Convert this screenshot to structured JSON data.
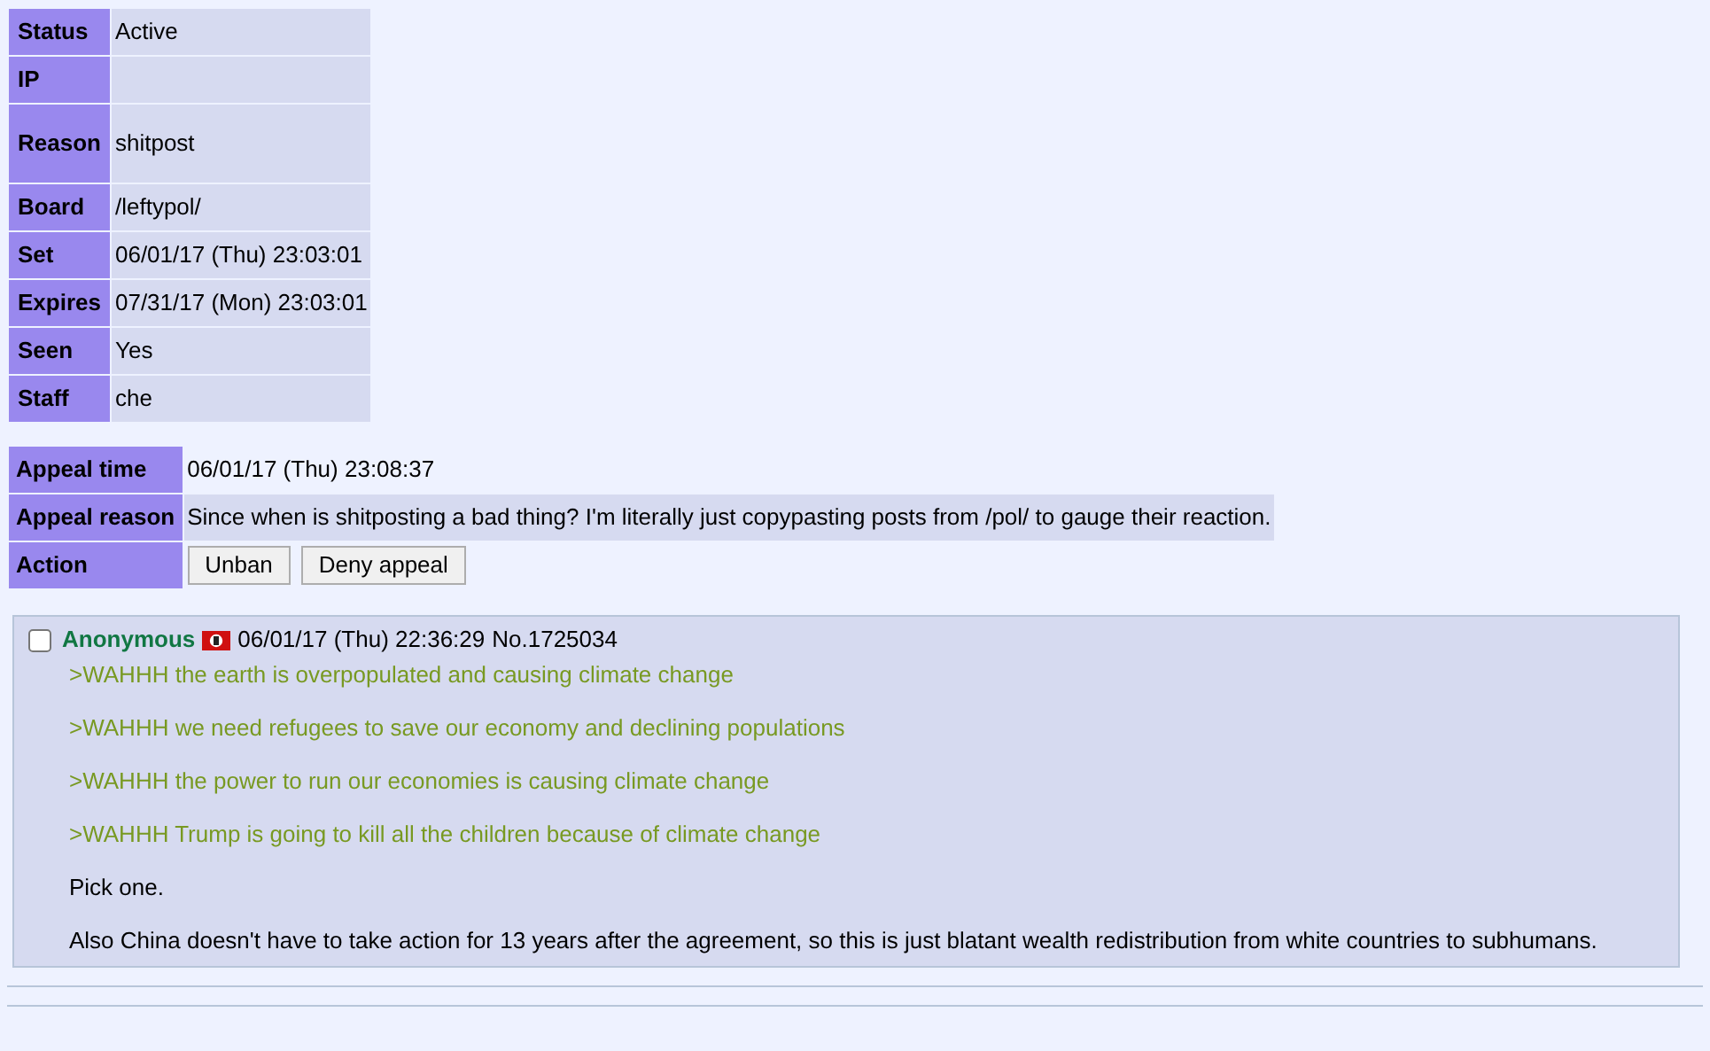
{
  "ban": [
    {
      "label": "Status",
      "value": "Active"
    },
    {
      "label": "IP"
    },
    {
      "label": "Reason",
      "value": "shitpost",
      "tall": true
    },
    {
      "label": "Board",
      "value": "/leftypol/"
    },
    {
      "label": "Set",
      "value": "06/01/17 (Thu) 23:03:01"
    },
    {
      "label": "Expires",
      "value": "07/31/17 (Mon) 23:03:01"
    },
    {
      "label": "Seen",
      "value": "Yes"
    },
    {
      "label": "Staff",
      "value": "che"
    }
  ],
  "appeal": {
    "time_label": "Appeal time",
    "time": "06/01/17 (Thu) 23:08:37",
    "reason_label": "Appeal reason",
    "reason": "Since when is shitposting a bad thing? I'm literally just copypasting posts from /pol/ to gauge their reaction.",
    "action_label": "Action",
    "buttons": [
      "Unban",
      "Deny appeal"
    ]
  },
  "post": {
    "checked": false,
    "name": "Anonymous",
    "date": "06/01/17 (Thu) 22:36:29",
    "number": "No.1725034",
    "lines": [
      {
        "kind": "quote",
        "text": ">WAHHH the earth is overpopulated and causing climate change"
      },
      {
        "kind": "quote",
        "text": ">WAHHH we need refugees to save our economy and declining populations"
      },
      {
        "kind": "quote",
        "text": ">WAHHH the power to run our economies is causing climate change"
      },
      {
        "kind": "quote",
        "text": ">WAHHH Trump is going to kill all the children because of climate change"
      },
      {
        "kind": "plain",
        "text": "Pick one."
      },
      {
        "kind": "plain",
        "text": "Also China doesn't have to take action for 13 years after the agreement, so this is just blatant wealth redistribution from white countries to subhumans."
      }
    ]
  }
}
